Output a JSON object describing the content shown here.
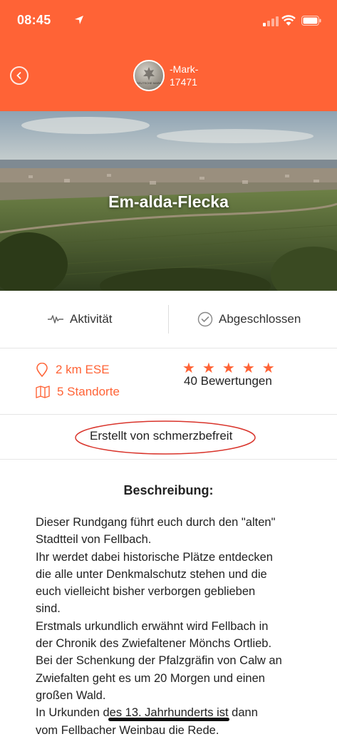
{
  "status_bar": {
    "time": "08:45"
  },
  "header": {
    "back_label": "back",
    "coin_name_line1": "-Mark-",
    "coin_name_line2": "17471",
    "coin_text": "DEUTSCHE MARK",
    "brand_color": "#FF6336"
  },
  "hero": {
    "title": "Em-alda-Flecka"
  },
  "tabs": [
    {
      "label": "Aktivität",
      "icon": "activity-icon"
    },
    {
      "label": "Abgeschlossen",
      "icon": "check-circle-icon"
    }
  ],
  "info": {
    "distance": "2 km ESE",
    "locations": "5 Standorte",
    "rating_stars": 5,
    "ratings_count": "40 Bewertungen"
  },
  "creator": {
    "label": "Erstellt von schmerzbefreit"
  },
  "description": {
    "title": "Beschreibung:",
    "lines": [
      "Dieser Rundgang führt euch durch den \"alten\"",
      "Stadtteil von Fellbach.",
      "Ihr werdet dabei historische Plätze entdecken",
      "die alle unter Denkmalschutz stehen und die",
      "euch vielleicht bisher verborgen geblieben",
      "sind.",
      "Erstmals urkundlich erwähnt wird Fellbach in",
      "der Chronik des Zwiefaltener Mönchs Ortlieb.",
      "Bei der Schenkung der Pfalzgräfin von Calw an",
      "Zwiefalten geht es um 20 Morgen und einen",
      "großen Wald.",
      "In Urkunden des 13. Jahrhunderts ist dann",
      "vom Fellbacher Weinbau die Rede."
    ]
  }
}
